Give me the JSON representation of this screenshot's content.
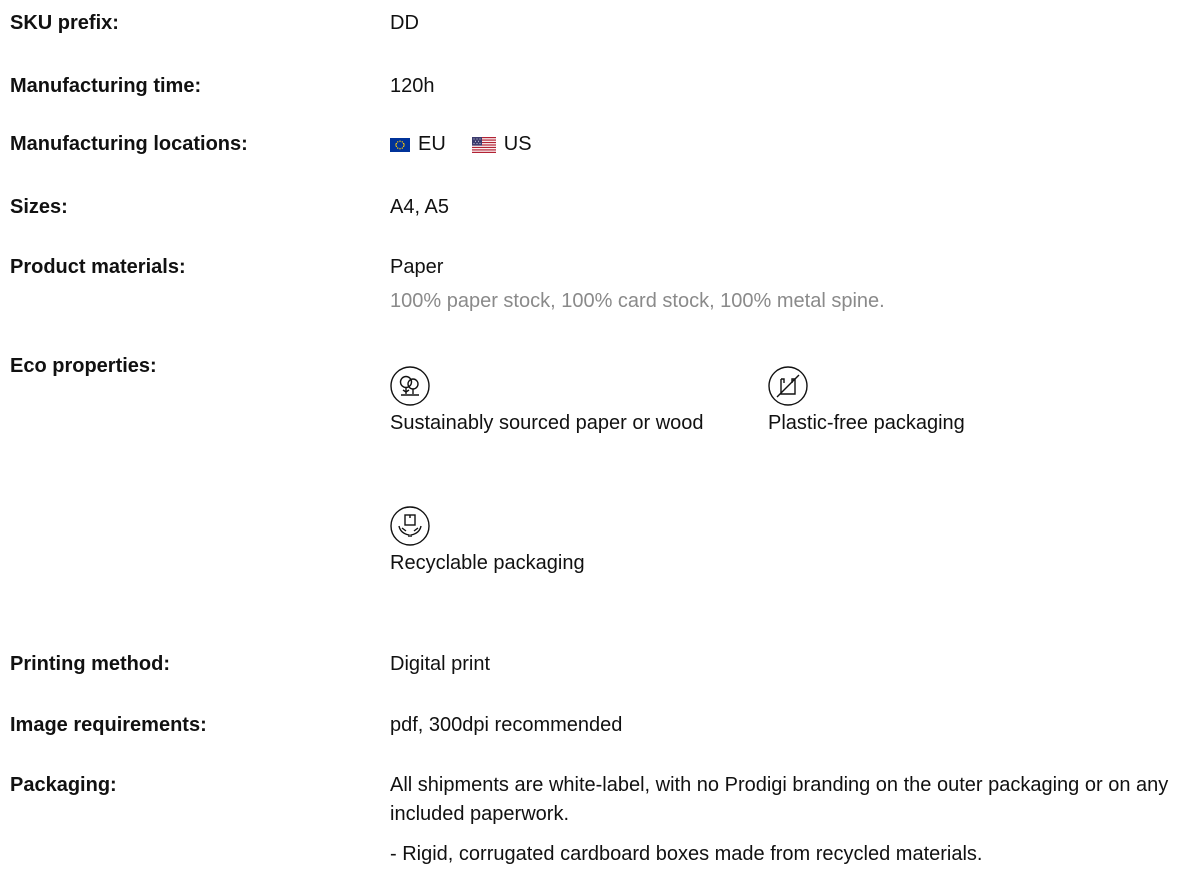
{
  "rows": {
    "sku": {
      "label": "SKU prefix:",
      "value": "DD"
    },
    "time": {
      "label": "Manufacturing time:",
      "value": "120h"
    },
    "locations": {
      "label": "Manufacturing locations:",
      "eu": "EU",
      "us": "US"
    },
    "sizes": {
      "label": "Sizes:",
      "value": "A4, A5"
    },
    "materials": {
      "label": "Product materials:",
      "value": "Paper",
      "detail": "100% paper stock, 100% card stock, 100% metal spine."
    },
    "eco": {
      "label": "Eco properties:",
      "items": [
        {
          "icon": "tree-icon",
          "text": "Sustainably sourced paper or wood"
        },
        {
          "icon": "no-plastic-bag-icon",
          "text": "Plastic-free packaging"
        },
        {
          "icon": "hands-box-icon",
          "text": "Recyclable packaging"
        }
      ]
    },
    "printing": {
      "label": "Printing method:",
      "value": "Digital print"
    },
    "image": {
      "label": "Image requirements:",
      "value": "pdf, 300dpi recommended"
    },
    "packaging": {
      "label": "Packaging:",
      "text1": "All shipments are white-label, with no Prodigi branding on the outer packaging or on any included paperwork.",
      "text2": "- Rigid, corrugated cardboard boxes made from recycled materials."
    }
  },
  "colors": {
    "text": "#111111",
    "muted": "#8a8a8a",
    "eu_blue": "#003399",
    "eu_star": "#ffcc00",
    "us_red": "#b22234",
    "us_blue": "#3c3b6e"
  }
}
